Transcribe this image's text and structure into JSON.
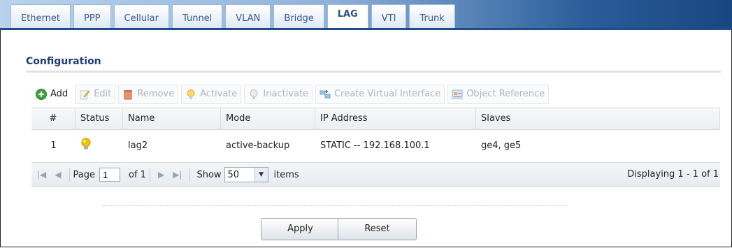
{
  "tabs": [
    "Ethernet",
    "PPP",
    "Cellular",
    "Tunnel",
    "VLAN",
    "Bridge",
    "LAG",
    "VTI",
    "Trunk"
  ],
  "active_tab": "LAG",
  "section": {
    "title": "Configuration"
  },
  "toolbar": {
    "add": "Add",
    "edit": "Edit",
    "remove": "Remove",
    "activate": "Activate",
    "inactivate": "Inactivate",
    "create_virtual": "Create Virtual Interface",
    "object_ref": "Object Reference"
  },
  "table": {
    "headers": [
      "#",
      "Status",
      "Name",
      "Mode",
      "IP Address",
      "Slaves"
    ],
    "rows": [
      {
        "num": "1",
        "status": "active-bulb-icon",
        "name": "lag2",
        "mode": "active-backup",
        "ip": "STATIC -- 192.168.100.1",
        "slaves": "ge4, ge5"
      }
    ]
  },
  "pager": {
    "page_label": "Page",
    "page_value": "1",
    "of_label": "of 1",
    "show_label": "Show",
    "show_value": "50",
    "items_label": "items",
    "displaying": "Displaying 1 - 1 of 1"
  },
  "buttons": {
    "apply": "Apply",
    "reset": "Reset"
  },
  "colors": {
    "accent": "#1e3d75",
    "bulb": "#f2c200"
  }
}
